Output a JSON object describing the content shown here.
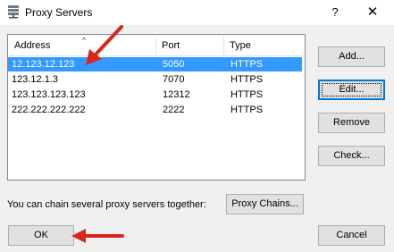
{
  "window": {
    "title": "Proxy Servers",
    "help_label": "?",
    "close_label": "✕",
    "icon": "server-icon"
  },
  "list": {
    "columns": [
      "Address",
      "Port",
      "Type"
    ],
    "sort_indicator": "^",
    "rows": [
      {
        "address": "12.123.12.123",
        "port": "5050",
        "type": "HTTPS",
        "selected": true
      },
      {
        "address": "123.12.1.3",
        "port": "7070",
        "type": "HTTPS",
        "selected": false
      },
      {
        "address": "123.123.123.123",
        "port": "12312",
        "type": "HTTPS",
        "selected": false
      },
      {
        "address": "222.222.222.222",
        "port": "2222",
        "type": "HTTPS",
        "selected": false
      }
    ]
  },
  "buttons": {
    "add": "Add...",
    "edit": "Edit...",
    "remove": "Remove",
    "check": "Check...",
    "proxy_chains": "Proxy Chains...",
    "ok": "OK",
    "cancel": "Cancel"
  },
  "hint": "You can chain several proxy servers together:",
  "colors": {
    "selection": "#3399ff",
    "annotation_arrow": "#d9251c"
  }
}
